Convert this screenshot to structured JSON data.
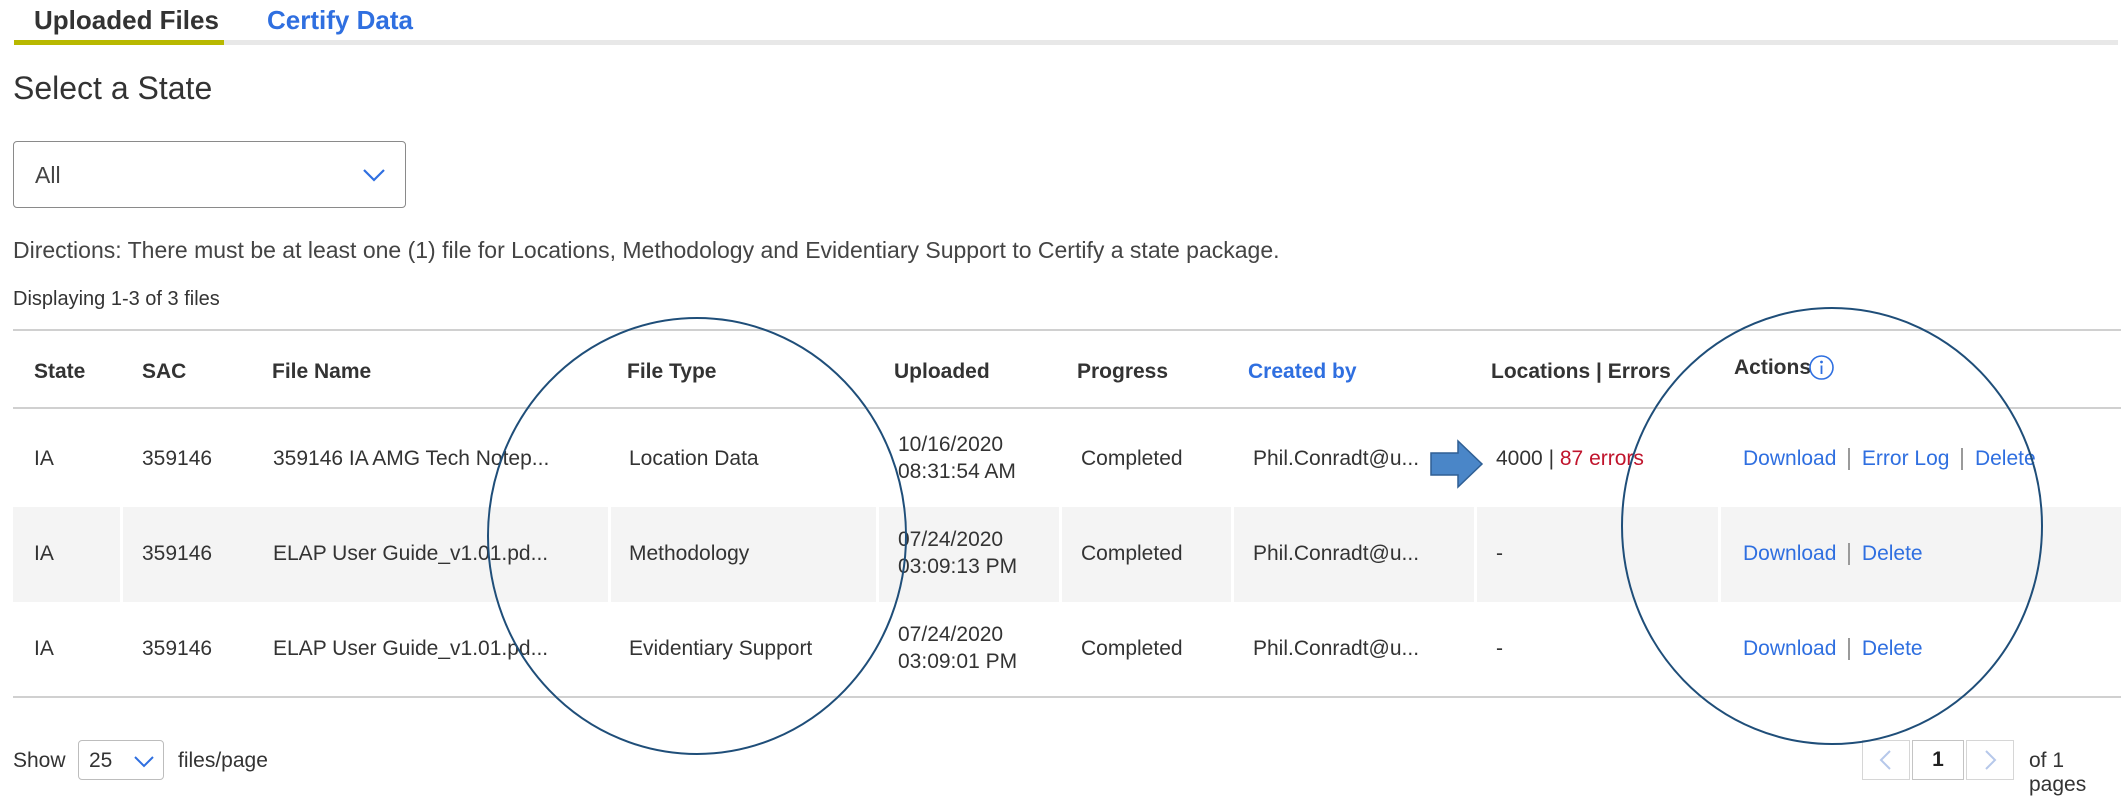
{
  "tabs": [
    {
      "label": "Uploaded Files",
      "active": true
    },
    {
      "label": "Certify Data",
      "active": false
    }
  ],
  "section_title": "Select a State",
  "state_select": {
    "value": "All",
    "icon": "chevron-down-icon"
  },
  "directions": "Directions: There must be at least one (1) file for Locations, Methodology and Evidentiary Support to Certify a state package.",
  "displaying": "Displaying 1-3 of 3 files",
  "table": {
    "headers": {
      "state": "State",
      "sac": "SAC",
      "file_name": "File Name",
      "file_type": "File Type",
      "uploaded": "Uploaded",
      "progress": "Progress",
      "created_by": "Created by",
      "locations_errors": "Locations | Errors",
      "actions": "Actions"
    },
    "actions_info_icon": "info-circle-icon",
    "rows": [
      {
        "state": "IA",
        "sac": "359146",
        "file_name": "359146 IA AMG Tech Notep...",
        "file_type": "Location Data",
        "uploaded_date": "10/16/2020",
        "uploaded_time": "08:31:54 AM",
        "progress": "Completed",
        "created_by": "Phil.Conradt@u...",
        "locations": "4000",
        "loc_sep": "|",
        "errors": "87 errors",
        "actions": [
          "Download",
          "Error Log",
          "Delete"
        ]
      },
      {
        "state": "IA",
        "sac": "359146",
        "file_name": "ELAP User Guide_v1.01.pd...",
        "file_type": "Methodology",
        "uploaded_date": "07/24/2020",
        "uploaded_time": "03:09:13 PM",
        "progress": "Completed",
        "created_by": "Phil.Conradt@u...",
        "locations": "-",
        "errors": "",
        "actions": [
          "Download",
          "Delete"
        ]
      },
      {
        "state": "IA",
        "sac": "359146",
        "file_name": "ELAP User Guide_v1.01.pd...",
        "file_type": "Evidentiary Support",
        "uploaded_date": "07/24/2020",
        "uploaded_time": "03:09:01 PM",
        "progress": "Completed",
        "created_by": "Phil.Conradt@u...",
        "locations": "-",
        "errors": "",
        "actions": [
          "Download",
          "Delete"
        ]
      }
    ]
  },
  "footer": {
    "show_label": "Show",
    "page_size": "25",
    "files_per_page": "files/page",
    "current_page": "1",
    "of_pages": "of 1 pages"
  },
  "annotations": {
    "arrow_color": "#4a86c8",
    "circle_color": "#1f4e79"
  },
  "colors": {
    "link": "#2f6fe0",
    "active_tab_underline": "#b8b800",
    "error": "#c0142c"
  }
}
